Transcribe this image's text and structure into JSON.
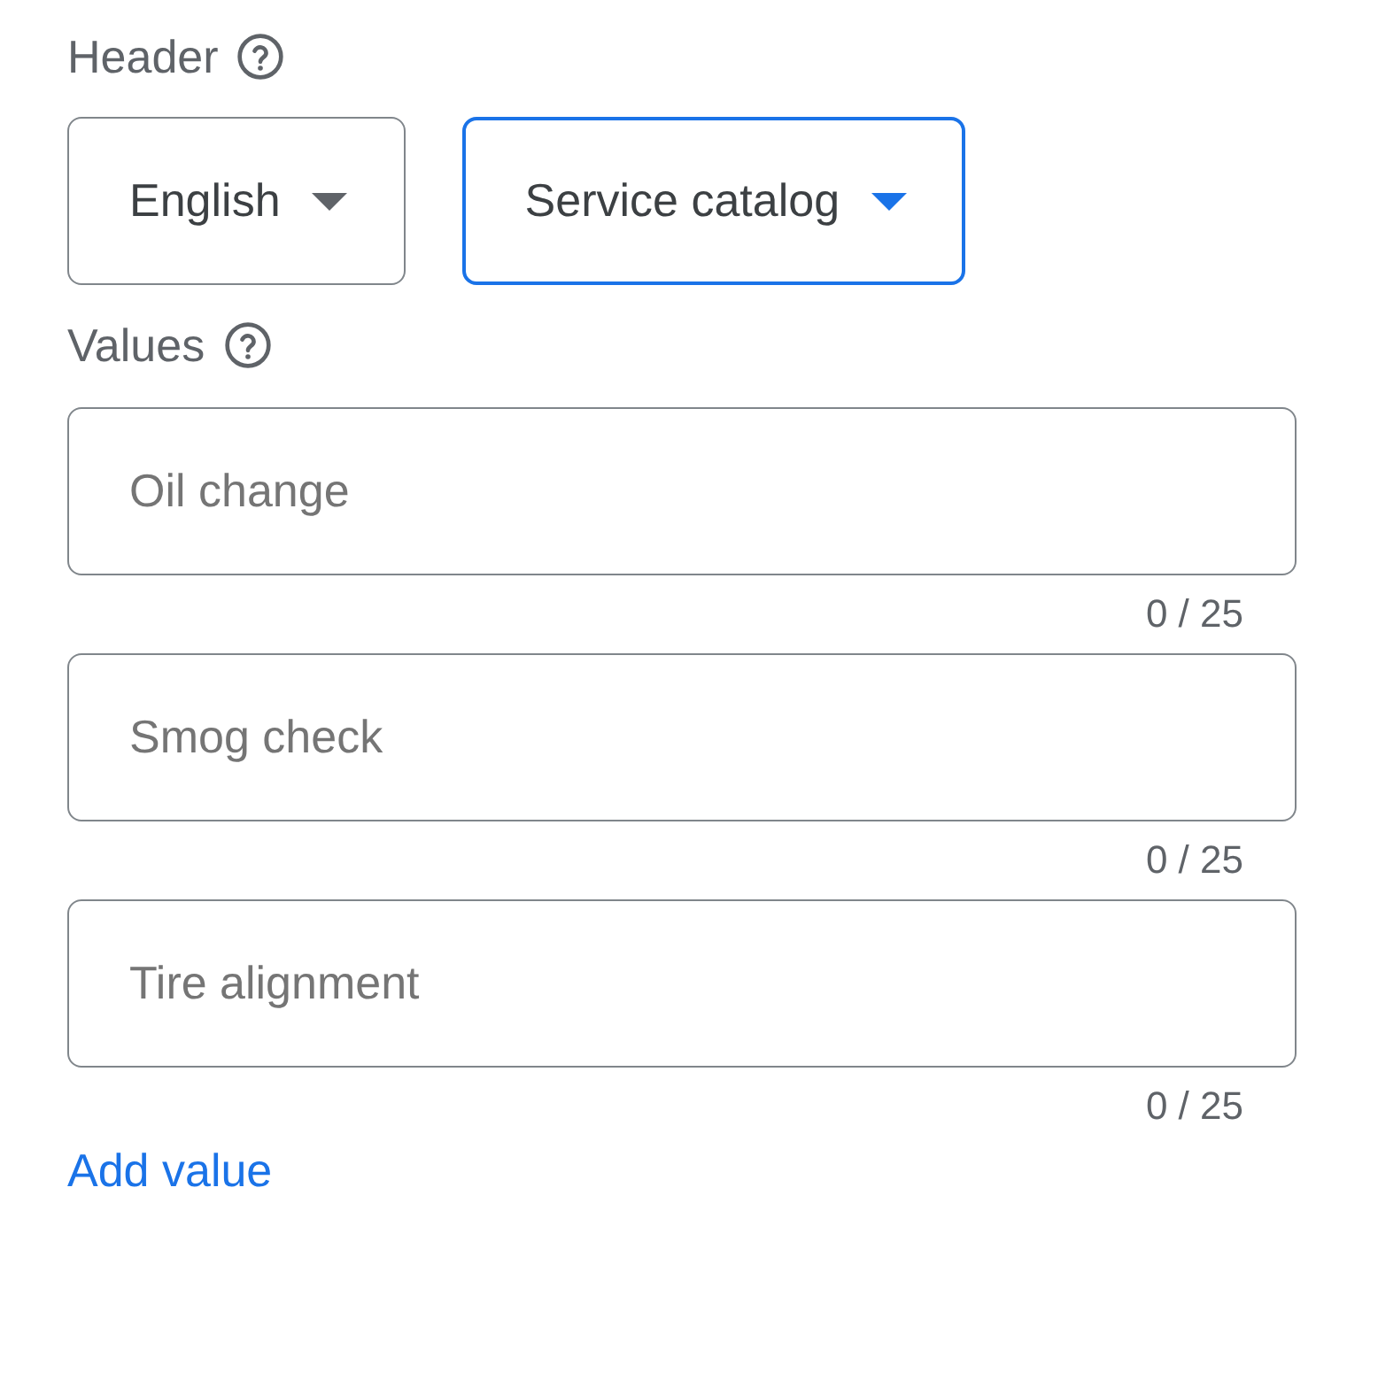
{
  "header": {
    "label": "Header",
    "dropdowns": [
      {
        "value": "English",
        "focused": false
      },
      {
        "value": "Service catalog",
        "focused": true
      }
    ]
  },
  "values": {
    "label": "Values",
    "fields": [
      {
        "placeholder": "Oil change",
        "counter": "0 / 25"
      },
      {
        "placeholder": "Smog check",
        "counter": "0 / 25"
      },
      {
        "placeholder": "Tire alignment",
        "counter": "0 / 25"
      }
    ]
  },
  "add_link": "Add value"
}
